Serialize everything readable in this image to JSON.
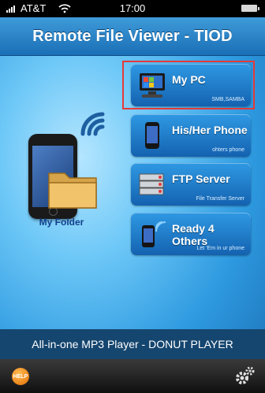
{
  "status_bar": {
    "carrier": "AT&T",
    "time": "17:00"
  },
  "title": "Remote File Viewer - TIOD",
  "left": {
    "label": "My Folder"
  },
  "buttons": [
    {
      "label": "My PC",
      "sub": "SMB,SAMBA"
    },
    {
      "label": "His/Her Phone",
      "sub": "ohters phone"
    },
    {
      "label": "FTP Server",
      "sub": "File Transfer Server"
    },
    {
      "label": "Ready 4 Others",
      "sub": "Let 'Em in ur phone"
    }
  ],
  "mp3bar": {
    "text": "All-in-one MP3 Player - DONUT PLAYER"
  },
  "toolbar": {
    "help_label": "HELP"
  },
  "colors": {
    "highlight": "#e53a3a"
  }
}
